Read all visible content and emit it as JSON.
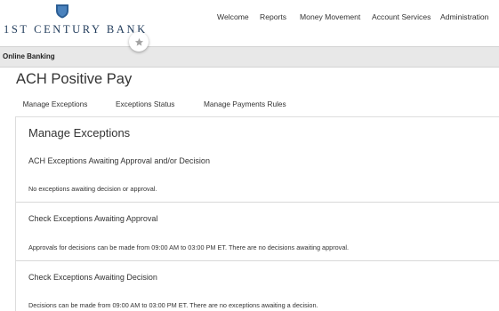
{
  "header": {
    "logo_text": "1st Century Bank",
    "nav": [
      "Welcome",
      "Reports",
      "Money Movement",
      "Account Services",
      "Administration"
    ]
  },
  "breadcrumb": {
    "label": "Online Banking"
  },
  "page": {
    "title": "ACH Positive Pay",
    "tabs": [
      "Manage Exceptions",
      "Exceptions Status",
      "Manage Payments Rules"
    ],
    "active_tab": "Manage Exceptions"
  },
  "content": {
    "section_title": "Manage Exceptions",
    "blocks": [
      {
        "heading": "ACH Exceptions Awaiting Approval and/or Decision",
        "text": "No exceptions awaiting decision or approval."
      },
      {
        "heading": "Check Exceptions Awaiting Approval",
        "text": "Approvals for decisions can be made from 09:00 AM to 03:00 PM ET. There are no decisions awaiting approval."
      },
      {
        "heading": "Check Exceptions Awaiting Decision",
        "text": "Decisions can be made from 09:00 AM to 03:00 PM ET. There are no exceptions awaiting a decision."
      }
    ]
  },
  "colors": {
    "brand_navy": "#1f3a5a",
    "shield_blue": "#2c5f95",
    "tab_underline": "#8a8a8a"
  },
  "icons": {
    "logo": "shield-logo-icon",
    "favorite": "star-icon"
  }
}
